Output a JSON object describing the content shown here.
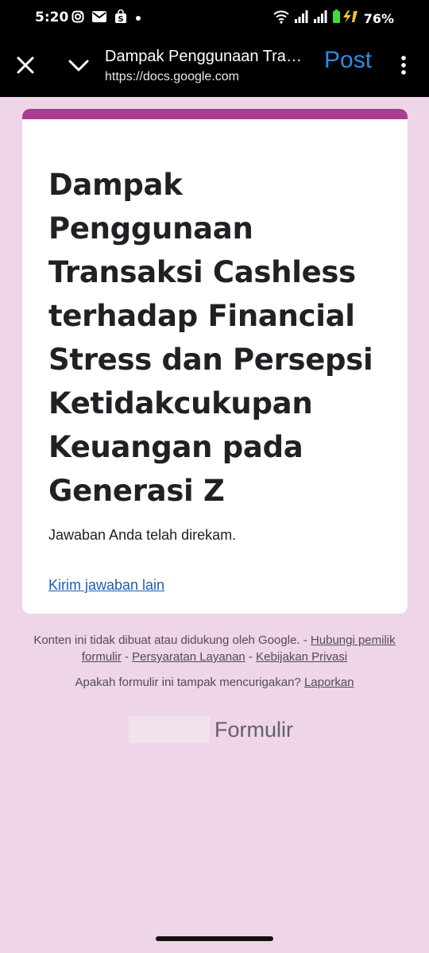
{
  "status_bar": {
    "time": "5:20",
    "battery_percent": "76%",
    "icons": [
      "instagram-icon",
      "gmail-icon",
      "shopping-bag-icon",
      "dot-icon",
      "wifi-icon",
      "signal-icon",
      "signal-icon",
      "battery-charging-icon"
    ]
  },
  "app_bar": {
    "title": "Dampak Penggunaan Transaksi Cashless terhadap Financial Stress dan Persepsi Ketidakcukupan Keuangan pada Generasi Z",
    "url": "https://docs.google.com",
    "post_label": "Post"
  },
  "form": {
    "accent_color": "#ad3b91",
    "title": "Dampak Penggunaan Transaksi Cashless terhadap Financial Stress dan Persepsi Ketidakcukupan Keuangan pada Generasi Z",
    "confirmation": "Jawaban Anda telah direkam.",
    "another_response_link": "Kirim jawaban lain"
  },
  "footer": {
    "disclaimer": "Konten ini tidak dibuat atau didukung oleh Google. -",
    "contact_link": "Hubungi pemilik formulir",
    "sep1": "-",
    "terms_link": "Persyaratan Layanan",
    "sep2": "-",
    "privacy_link": "Kebijakan Privasi",
    "suspicious_question": "Apakah formulir ini tampak mencurigakan?",
    "report_link": "Laporkan",
    "logo_text": "Formulir"
  }
}
